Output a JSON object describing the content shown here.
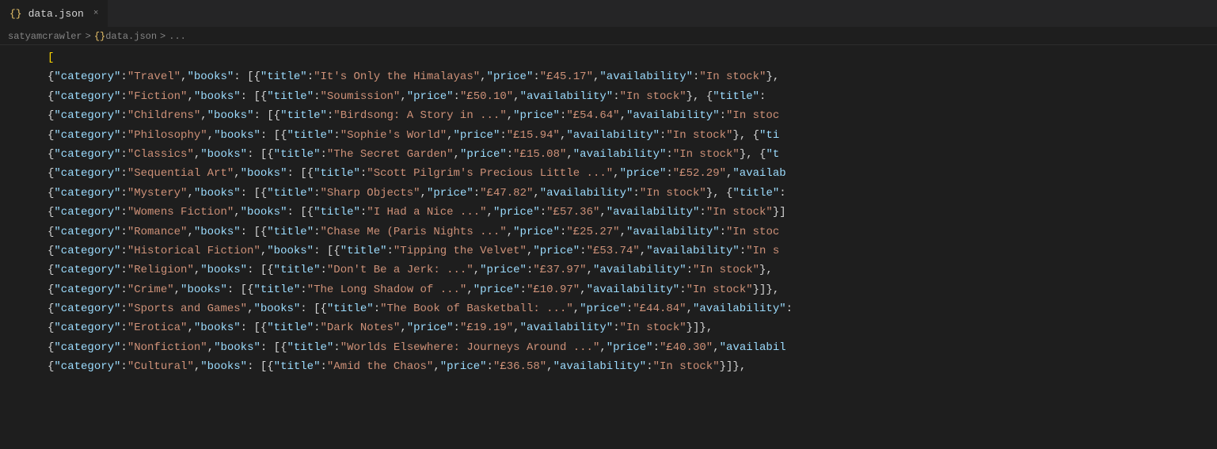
{
  "tab": {
    "icon": "{}",
    "name": "data.json",
    "close": "×"
  },
  "breadcrumb": {
    "parts": [
      "satyamcrawler",
      ">",
      "{}",
      "data.json",
      ">",
      "..."
    ]
  },
  "lines": [
    {
      "content": "    ["
    },
    {
      "content": "    {\"category\": \"Travel\", \"books\": [{\"title\": \"It's Only the Himalayas\", \"price\": \"£45.17\", \"availability\": \"In stock\"},"
    },
    {
      "content": "    {\"category\": \"Fiction\", \"books\": [{\"title\": \"Soumission\", \"price\": \"£50.10\", \"availability\": \"In stock\"}, {\"title\":"
    },
    {
      "content": "    {\"category\": \"Childrens\", \"books\": [{\"title\": \"Birdsong: A Story in ...\", \"price\": \"£54.64\", \"availability\": \"In stoc"
    },
    {
      "content": "    {\"category\": \"Philosophy\", \"books\": [{\"title\": \"Sophie's World\", \"price\": \"£15.94\", \"availability\": \"In stock\"}, {\"ti"
    },
    {
      "content": "    {\"category\": \"Classics\", \"books\": [{\"title\": \"The Secret Garden\", \"price\": \"£15.08\", \"availability\": \"In stock\"}, {\"t"
    },
    {
      "content": "    {\"category\": \"Sequential Art\", \"books\": [{\"title\": \"Scott Pilgrim's Precious Little ...\", \"price\": \"£52.29\", \"availab"
    },
    {
      "content": "    {\"category\": \"Mystery\", \"books\": [{\"title\": \"Sharp Objects\", \"price\": \"£47.82\", \"availability\": \"In stock\"}, {\"title\":"
    },
    {
      "content": "    {\"category\": \"Womens Fiction\", \"books\": [{\"title\": \"I Had a Nice ...\", \"price\": \"£57.36\", \"availability\": \"In stock\"}]"
    },
    {
      "content": "    {\"category\": \"Romance\", \"books\": [{\"title\": \"Chase Me (Paris Nights ...\", \"price\": \"£25.27\", \"availability\": \"In stoc"
    },
    {
      "content": "    {\"category\": \"Historical Fiction\", \"books\": [{\"title\": \"Tipping the Velvet\", \"price\": \"£53.74\", \"availability\": \"In s"
    },
    {
      "content": "    {\"category\": \"Religion\", \"books\": [{\"title\": \"Don't Be a Jerk: ...\", \"price\": \"£37.97\", \"availability\": \"In stock\"},"
    },
    {
      "content": "    {\"category\": \"Crime\", \"books\": [{\"title\": \"The Long Shadow of ...\", \"price\": \"£10.97\", \"availability\": \"In stock\"}]},"
    },
    {
      "content": "    {\"category\": \"Sports and Games\", \"books\": [{\"title\": \"The Book of Basketball: ...\", \"price\": \"£44.84\", \"availability\":"
    },
    {
      "content": "    {\"category\": \"Erotica\", \"books\": [{\"title\": \"Dark Notes\", \"price\": \"£19.19\", \"availability\": \"In stock\"}]},"
    },
    {
      "content": "    {\"category\": \"Nonfiction\", \"books\": [{\"title\": \"Worlds Elsewhere: Journeys Around ...\", \"price\": \"£40.30\", \"availabil"
    },
    {
      "content": "    {\"category\": \"Cultural\", \"books\": [{\"title\": \"Amid the Chaos\", \"price\": \"£36.58\", \"availability\": \"In stock\"}]},"
    }
  ]
}
